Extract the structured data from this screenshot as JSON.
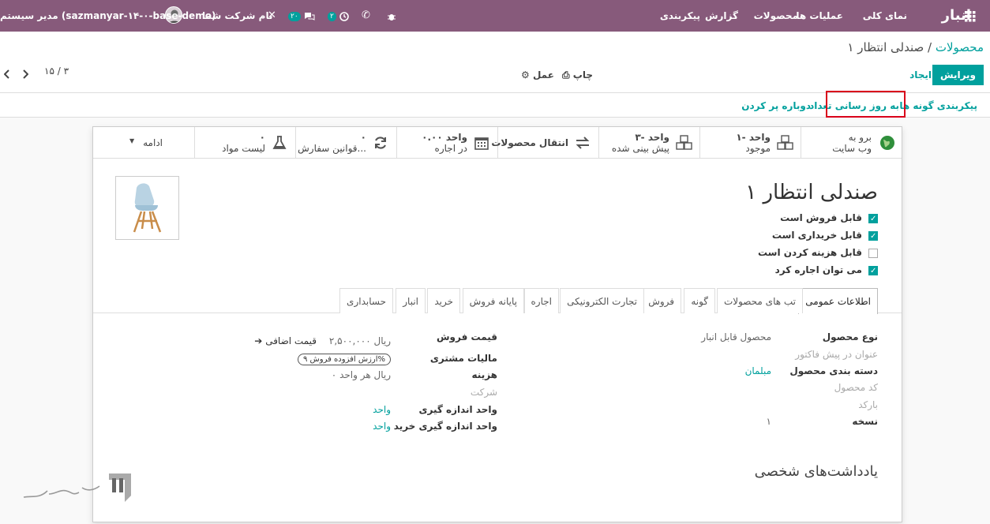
{
  "topbar": {
    "app_name": "انبار",
    "menu": [
      "نمای کلی",
      "عملیات ها",
      "محصولات",
      "گزارش",
      "پیکربندی"
    ],
    "activity_count": "۲",
    "messages_count": "۲۰",
    "company_name": "نام شرکت شما",
    "user_name": "مدیر سیستم (sazmanyar-۱۴-۰-base-demo)"
  },
  "control": {
    "breadcrumb_parent": "محصولات",
    "breadcrumb_sep": "/",
    "breadcrumb_current": "صندلی انتظار ۱",
    "edit_label": "ویرایش",
    "create_label": "ایجاد",
    "print_label": "چاپ",
    "action_label": "عمل",
    "pager": "۱۵ / ۳"
  },
  "statusbar": {
    "buttons": [
      "پیکربندی گونه ها",
      "به روز رسانی تعداد",
      "دوباره پر کردن"
    ]
  },
  "smart_buttons": {
    "website": {
      "line1": "برو به",
      "line2": "وب سایت"
    },
    "on_hand": {
      "line1": "۱- واحد",
      "line2": "موجود"
    },
    "forecast": {
      "line1": "۳- واحد",
      "line2": "پیش بینی شده"
    },
    "moves": {
      "line1": "انتقال محصولات"
    },
    "rental": {
      "line1": "۰.۰۰ واحد",
      "line2": "در اجاره"
    },
    "rules": {
      "line1": "۰",
      "line2": "قوانین سفارش..."
    },
    "bom": {
      "line1": "۰",
      "line2": "لیست مواد"
    },
    "more": "ادامه"
  },
  "product": {
    "name": "صندلی انتظار ۱",
    "checks": [
      {
        "label": "قابل فروش است",
        "checked": true
      },
      {
        "label": "قابل خریداری است",
        "checked": true
      },
      {
        "label": "قابل هزینه کردن است",
        "checked": false
      },
      {
        "label": "می توان اجاره کرد",
        "checked": true
      }
    ]
  },
  "tabs": [
    "اطلاعات عمومی",
    "تب های محصولات",
    "گونه",
    "فروش",
    "تجارت الکترونیکی",
    "اجاره",
    "پایانه فروش",
    "خرید",
    "انبار",
    "حسابداری"
  ],
  "general": {
    "product_type_label": "نوع محصول",
    "product_type_value": "محصول قابل انبار",
    "invoice_title_placeholder": "عنوان در پیش فاکتور",
    "category_label": "دسته بندی محصول",
    "category_value": "مبلمان",
    "code_placeholder": "کد محصول",
    "barcode_placeholder": "بارکد",
    "version_label": "نسخه",
    "version_value": "۱",
    "sale_price_label": "قیمت فروش",
    "sale_price_value": "۲,۵۰۰,۰۰۰ ریال",
    "extra_price_label": "قیمت اضافی",
    "customer_tax_label": "مالیات مشتری",
    "customer_tax_value": "ارزش افزوده فروش ۹%",
    "cost_label": "هزینه",
    "cost_value": "۰ ریال هر واحد",
    "company_placeholder": "شرکت",
    "uom_label": "واحد اندازه گیری",
    "uom_value": "واحد",
    "purchase_uom_label": "واحد اندازه گیری خرید",
    "purchase_uom_value": "واحد"
  },
  "notes_title": "یادداشت‌های شخصی",
  "colors": {
    "topbar": "#875a7b",
    "accent": "#00a09d",
    "highlight": "#d9001b"
  }
}
